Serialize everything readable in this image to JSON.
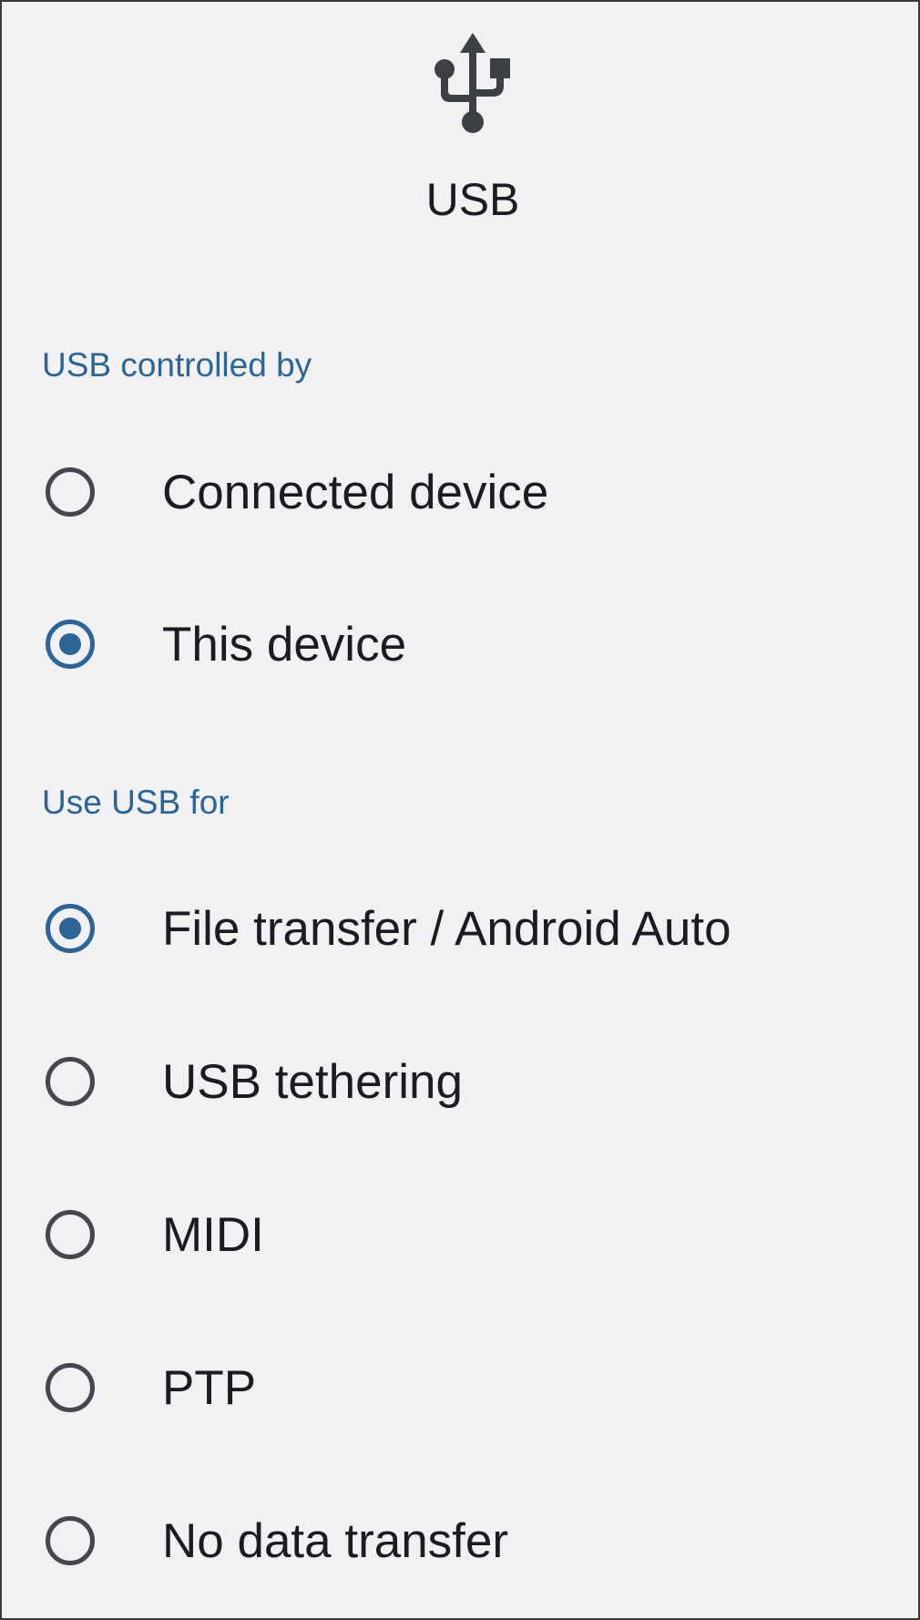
{
  "dialog": {
    "icon": "usb-icon",
    "title": "USB"
  },
  "controlled_by": {
    "header": "USB controlled by",
    "options": [
      {
        "label": "Connected device",
        "selected": false
      },
      {
        "label": "This device",
        "selected": true
      }
    ]
  },
  "use_for": {
    "header": "Use USB for",
    "options": [
      {
        "label": "File transfer / Android Auto",
        "selected": true
      },
      {
        "label": "USB tethering",
        "selected": false
      },
      {
        "label": "MIDI",
        "selected": false
      },
      {
        "label": "PTP",
        "selected": false
      },
      {
        "label": "No data transfer",
        "selected": false
      }
    ]
  },
  "colors": {
    "background": "#f1f1f4",
    "accent": "#2d6494",
    "text": "#1d1b20",
    "radio_unchecked": "#44474e"
  }
}
